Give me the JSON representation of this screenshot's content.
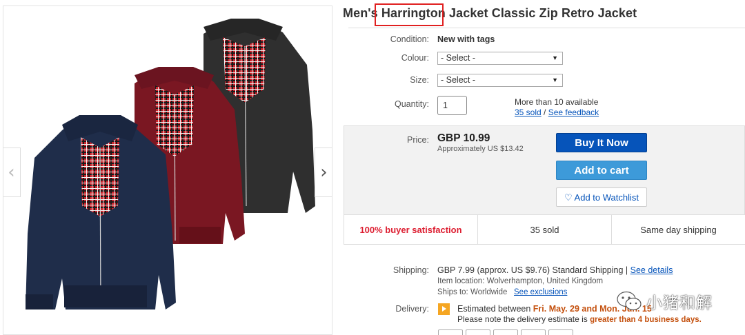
{
  "product": {
    "title": "Men's Harrington Jacket Classic Zip Retro Jacket",
    "highlighted_word": "Harrington"
  },
  "condition": {
    "label": "Condition:",
    "value": "New with tags"
  },
  "colour": {
    "label": "Colour:",
    "selected": "- Select -"
  },
  "size": {
    "label": "Size:",
    "selected": "- Select -"
  },
  "quantity": {
    "label": "Quantity:",
    "value": "1",
    "availability": "More than 10 available",
    "sold_link": "35 sold",
    "separator": "/",
    "feedback_link": "See feedback"
  },
  "pricing": {
    "label": "Price:",
    "price": "GBP 10.99",
    "approx": "Approximately US $13.42",
    "buy_now": "Buy It Now",
    "add_to_cart": "Add to cart",
    "watchlist": "Add to Watchlist"
  },
  "stats": [
    "100% buyer satisfaction",
    "35 sold",
    "Same day shipping"
  ],
  "shipping": {
    "label": "Shipping:",
    "cost": "GBP 7.99 (approx. US $9.76)",
    "method": "Standard Shipping |",
    "details_link": "See details",
    "location": "Item location:  Wolverhampton, United Kingdom",
    "ships_to": "Ships to:  Worldwide",
    "exclusions_link": "See exclusions"
  },
  "delivery": {
    "label": "Delivery:",
    "estimate_prefix": "Estimated between",
    "estimate_dates": "Fri. May. 29 and Mon. Jun. 15",
    "note_prefix": "Please note the delivery estimate is",
    "note_emphasis": "greater than 4 business days."
  },
  "watermark": {
    "text": "小猪和解"
  },
  "colors": {
    "buy_now": "#0654ba",
    "add_to_cart": "#3d9ad9",
    "highlight_box": "#e02020",
    "satisfaction": "#dd1e31",
    "delivery_emphasis": "#c4510f",
    "jacket_navy": "#1f2d4a",
    "jacket_burgundy": "#7a1722",
    "jacket_charcoal": "#2f2f2f"
  },
  "icons": {
    "prev": "chevron-left-icon",
    "next": "chevron-right-icon",
    "heart": "heart-icon",
    "delivery": "delivery-flag-icon",
    "watermark": "wechat-icon"
  }
}
